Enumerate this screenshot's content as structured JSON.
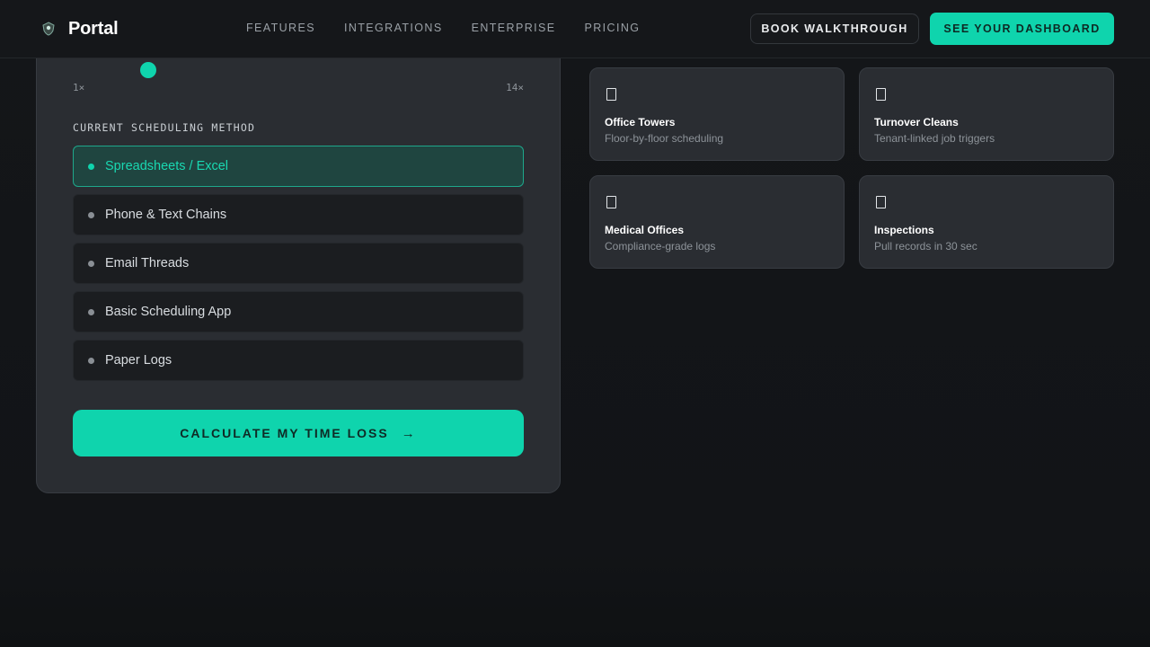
{
  "nav": {
    "brand": "Portal",
    "brand_icon": "shield-logo-icon",
    "links": [
      "FEATURES",
      "INTEGRATIONS",
      "ENTERPRISE",
      "PRICING"
    ],
    "walkthrough_label": "BOOK WALKTHROUGH",
    "dashboard_label": "SEE YOUR DASHBOARD"
  },
  "calculator": {
    "slider": {
      "min_label": "1×",
      "max_label": "14×",
      "value_fraction": 0.15
    },
    "method_heading": "CURRENT SCHEDULING METHOD",
    "methods": [
      {
        "label": "Spreadsheets / Excel",
        "selected": true
      },
      {
        "label": "Phone & Text Chains",
        "selected": false
      },
      {
        "label": "Email Threads",
        "selected": false
      },
      {
        "label": "Basic Scheduling App",
        "selected": false
      },
      {
        "label": "Paper Logs",
        "selected": false
      }
    ],
    "cta_label": "CALCULATE MY TIME LOSS",
    "cta_icon": "arrow-right-icon"
  },
  "cards": [
    {
      "title": "Office Towers",
      "subtitle": "Floor-by-floor scheduling",
      "icon": "building-icon"
    },
    {
      "title": "Turnover Cleans",
      "subtitle": "Tenant-linked job triggers",
      "icon": "clipboard-icon"
    },
    {
      "title": "Medical Offices",
      "subtitle": "Compliance-grade logs",
      "icon": "medical-icon"
    },
    {
      "title": "Inspections",
      "subtitle": "Pull records in 30 sec",
      "icon": "inspection-icon"
    }
  ],
  "colors": {
    "accent": "#0fd4ad",
    "background": "#121417",
    "panel": "#2a2d32"
  }
}
